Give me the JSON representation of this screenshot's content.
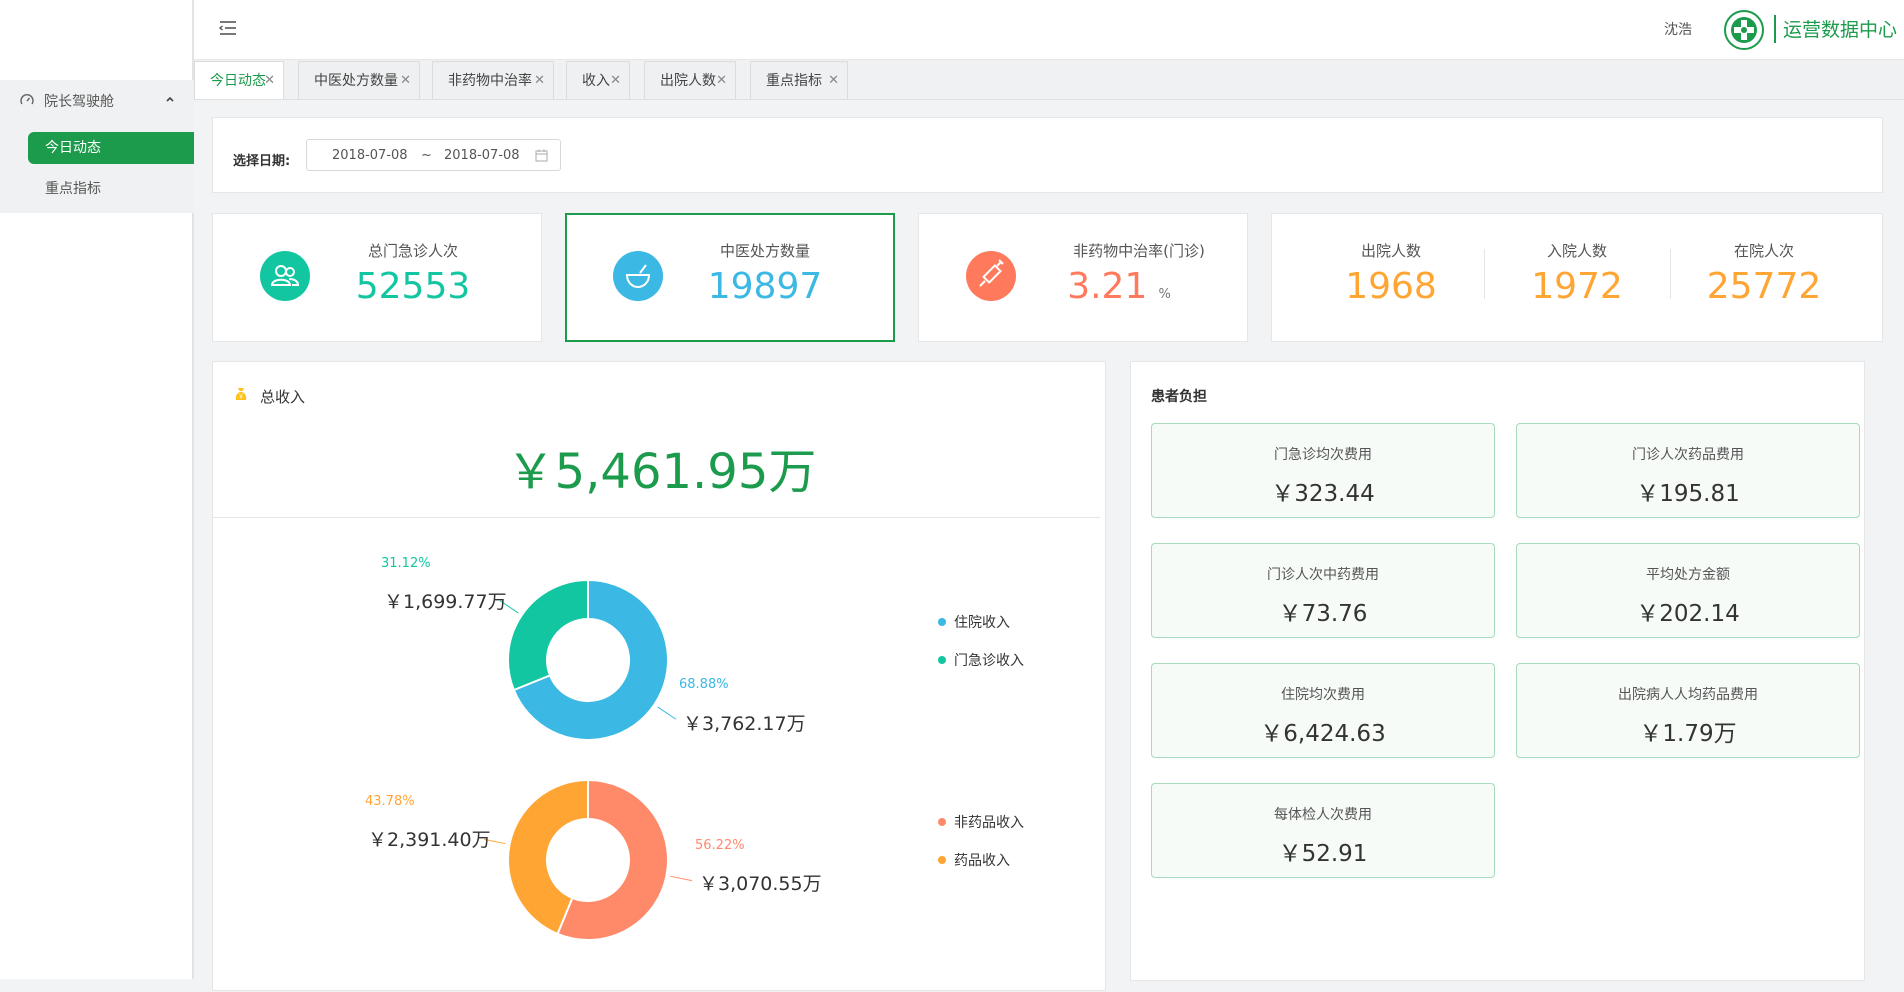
{
  "sidebar": {
    "group_label": "院长驾驶舱",
    "items": [
      {
        "label": "今日动态"
      },
      {
        "label": "重点指标"
      }
    ]
  },
  "header": {
    "user": "沈浩",
    "brand": "运营数据中心"
  },
  "tabs": [
    {
      "label": "今日动态"
    },
    {
      "label": "中医处方数量"
    },
    {
      "label": "非药物中治率"
    },
    {
      "label": "收入"
    },
    {
      "label": "出院人数"
    },
    {
      "label": "重点指标"
    }
  ],
  "filter": {
    "label": "选择日期:",
    "start": "2018-07-08",
    "sep": "~",
    "end": "2018-07-08"
  },
  "stats": {
    "outpatient": {
      "label": "总门急诊人次",
      "value": "52553"
    },
    "tcm_rx": {
      "label": "中医处方数量",
      "value": "19897"
    },
    "nondrug": {
      "label": "非药物中治率(门诊)",
      "value": "3.21",
      "unit": "%"
    },
    "discharged": {
      "label": "出院人数",
      "value": "1968"
    },
    "admitted": {
      "label": "入院人数",
      "value": "1972"
    },
    "inpatient": {
      "label": "在院人次",
      "value": "25772"
    }
  },
  "income": {
    "title": "总收入",
    "total": "￥5,461.95万"
  },
  "chart_data": [
    {
      "type": "pie",
      "donut": true,
      "legend": "right",
      "categories": [
        "住院收入",
        "门急诊收入"
      ],
      "values": [
        68.88,
        31.12
      ],
      "pct_labels": [
        "68.88%",
        "31.12%"
      ],
      "amount_labels": [
        "￥3,762.17万",
        "￥1,699.77万"
      ],
      "colors": [
        "#3bb8e3",
        "#13c6a2"
      ]
    },
    {
      "type": "pie",
      "donut": true,
      "legend": "right",
      "categories": [
        "非药品收入",
        "药品收入"
      ],
      "values": [
        56.22,
        43.78
      ],
      "pct_labels": [
        "56.22%",
        "43.78%"
      ],
      "amount_labels": [
        "￥3,070.55万",
        "￥2,391.40万"
      ],
      "colors": [
        "#ff8a6a",
        "#ffa534"
      ]
    }
  ],
  "burden": {
    "title": "患者负担",
    "items": [
      {
        "label": "门急诊均次费用",
        "value": "￥323.44"
      },
      {
        "label": "门诊人次药品费用",
        "value": "￥195.81"
      },
      {
        "label": "门诊人次中药费用",
        "value": "￥73.76"
      },
      {
        "label": "平均处方金额",
        "value": "￥202.14"
      },
      {
        "label": "住院均次费用",
        "value": "￥6,424.63"
      },
      {
        "label": "出院病人人均药品费用",
        "value": "￥1.79万"
      },
      {
        "label": "每体检人次费用",
        "value": "￥52.91"
      }
    ]
  },
  "colors": {
    "brand": "#1b9b4b",
    "teal": "#13c6a2",
    "blue": "#3bb8e3",
    "salmon": "#ff8a6a",
    "orange": "#ffa534"
  }
}
